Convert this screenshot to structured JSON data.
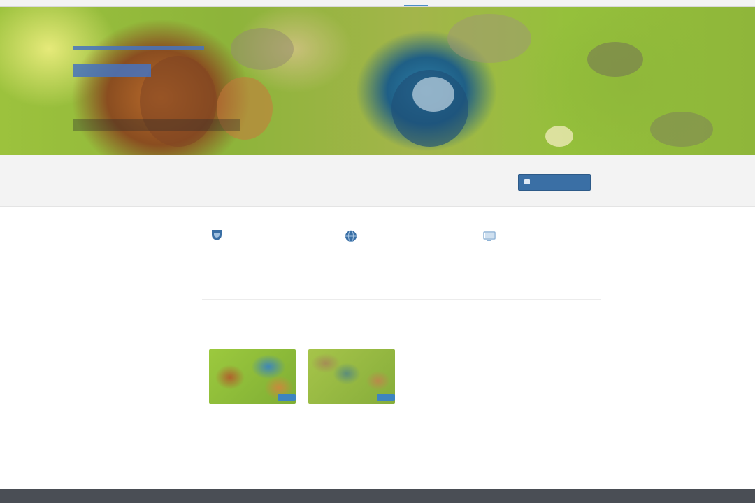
{
  "nav": {
    "tabs": [
      {
        "label": "",
        "active": true
      },
      {
        "label": "",
        "active": false
      },
      {
        "label": "",
        "active": false
      },
      {
        "label": "",
        "active": false
      }
    ]
  },
  "hero": {
    "title": "",
    "subtitle": "",
    "caption": ""
  },
  "intro": {
    "heading": "",
    "text": "",
    "download_label": ""
  },
  "features": [
    {
      "icon": "shield-icon",
      "title": "",
      "text": ""
    },
    {
      "icon": "globe-icon",
      "title": "",
      "text": ""
    },
    {
      "icon": "computer-icon",
      "title": "",
      "text": ""
    }
  ],
  "more": {
    "heading": "",
    "section_label": ""
  },
  "cards": [
    {
      "title": "",
      "text": ""
    },
    {
      "title": "",
      "text": ""
    }
  ],
  "colors": {
    "accent": "#3a6fa5",
    "link": "#5b9bd2",
    "footer": "#4a4e55",
    "band": "#f3f3f3"
  }
}
